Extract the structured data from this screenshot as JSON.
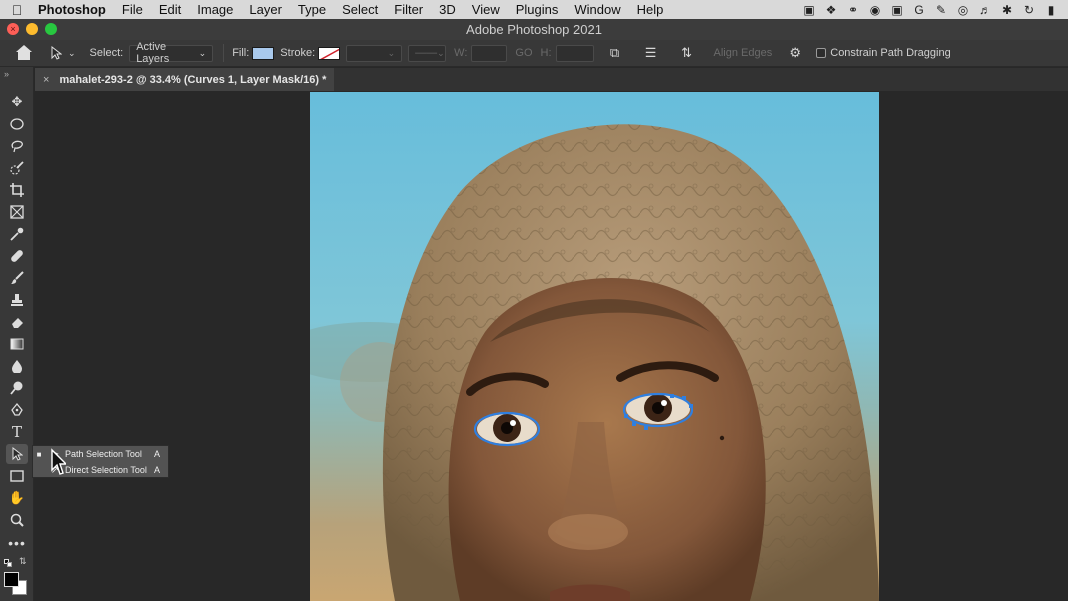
{
  "menubar": {
    "apple_icon": "apple-icon",
    "app_name": "Photoshop",
    "menus": [
      "File",
      "Edit",
      "Image",
      "Layer",
      "Type",
      "Select",
      "Filter",
      "3D",
      "View",
      "Plugins",
      "Window",
      "Help"
    ],
    "status_icons": [
      "screen-record-icon",
      "dropbox-icon",
      "creative-cloud-icon",
      "chrome-icon",
      "photo-icon",
      "grammarly-icon",
      "pen-icon",
      "cast-icon",
      "volume-icon",
      "bluetooth-icon",
      "time-machine-icon",
      "battery-icon"
    ]
  },
  "window": {
    "title": "Adobe Photoshop 2021"
  },
  "options_bar": {
    "select_label": "Select:",
    "select_value": "Active Layers",
    "fill_label": "Fill:",
    "fill_color": "#a9c9ec",
    "stroke_label": "Stroke:",
    "w_label": "W:",
    "go_label": "GO",
    "h_label": "H:",
    "align_edges_label": "Align Edges",
    "constrain_label": "Constrain Path Dragging"
  },
  "document": {
    "tab_title": "mahalet-293-2 @ 33.4% (Curves 1, Layer Mask/16) *"
  },
  "tools": [
    "move-tool-icon",
    "marquee-tool-icon",
    "lasso-tool-icon",
    "quick-selection-tool-icon",
    "crop-tool-icon",
    "frame-tool-icon",
    "eyedropper-tool-icon",
    "healing-brush-tool-icon",
    "brush-tool-icon",
    "clone-stamp-tool-icon",
    "eraser-tool-icon",
    "gradient-tool-icon",
    "blur-tool-icon",
    "dodge-tool-icon",
    "pen-tool-icon",
    "type-tool-icon",
    "path-selection-tool-icon",
    "rectangle-tool-icon",
    "hand-tool-icon",
    "zoom-tool-icon",
    "more-tools-icon"
  ],
  "flyout": {
    "items": [
      {
        "label": "Path Selection Tool",
        "key": "A",
        "selected": true
      },
      {
        "label": "Direct Selection Tool",
        "key": "A",
        "selected": false
      }
    ]
  },
  "colors": {
    "foreground": "#000000",
    "background": "#ffffff",
    "sky": "#6cc0dc",
    "path": "#2f7fe0"
  }
}
